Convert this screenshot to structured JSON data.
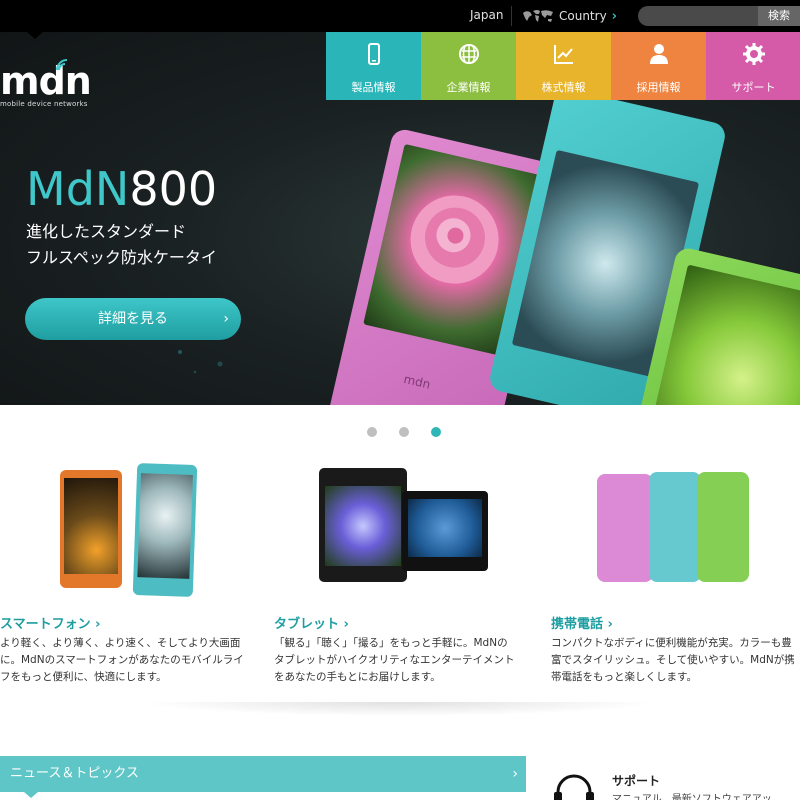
{
  "topbar": {
    "language": "Japan",
    "country_label": "Country",
    "search_placeholder": "",
    "search_button": "検索"
  },
  "logo": {
    "mark": "mdn",
    "tagline": "mobile device networks"
  },
  "nav": {
    "items": [
      {
        "label": "製品情報",
        "icon": "phone-icon",
        "color": "#2ab6b8"
      },
      {
        "label": "企業情報",
        "icon": "building-icon",
        "color": "#8cbf3f"
      },
      {
        "label": "株式情報",
        "icon": "chart-icon",
        "color": "#e8b42c"
      },
      {
        "label": "採用情報",
        "icon": "person-icon",
        "color": "#ef8440"
      },
      {
        "label": "サポート",
        "icon": "gear-icon",
        "color": "#d55aa8"
      }
    ]
  },
  "hero": {
    "title_accent": "MdN",
    "title_rest": "800",
    "subtitle_line1": "進化したスタンダード",
    "subtitle_line2": "フルスペック防水ケータイ",
    "button_label": "詳細を見る",
    "phone_brand": "mdn"
  },
  "carousel": {
    "dots": 3,
    "active_index": 2
  },
  "products": [
    {
      "title": "スマートフォン",
      "desc_lines": [
        "より軽く、より薄く、より速く、そしてより大画面",
        "に。MdNのスマートフォンがあなたのモバイルライ",
        "フをもっと便利に、快適にします。"
      ]
    },
    {
      "title": "タブレット",
      "desc_lines": [
        "「観る」「聴く」「撮る」をもっと手軽に。MdNの",
        "タブレットがハイクオリティなエンターテイメント",
        "をあなたの手もとにお届けします。"
      ]
    },
    {
      "title": "携帯電話",
      "desc_lines": [
        "コンパクトなボディに便利機能が充実。カラーも豊",
        "富でスタイリッシュ。そして使いやすい。MdNが携",
        "帯電話をもっと楽しくします。"
      ]
    }
  ],
  "news": {
    "title": "ニュース＆トピックス"
  },
  "support": {
    "title": "サポート",
    "desc": "マニュアル、最新ソフトウェアアッ"
  },
  "colors": {
    "accent": "#2fb7b8",
    "phone_pink": "#d877c8",
    "phone_teal": "#43c3c6",
    "phone_green": "#7ccd4b"
  }
}
